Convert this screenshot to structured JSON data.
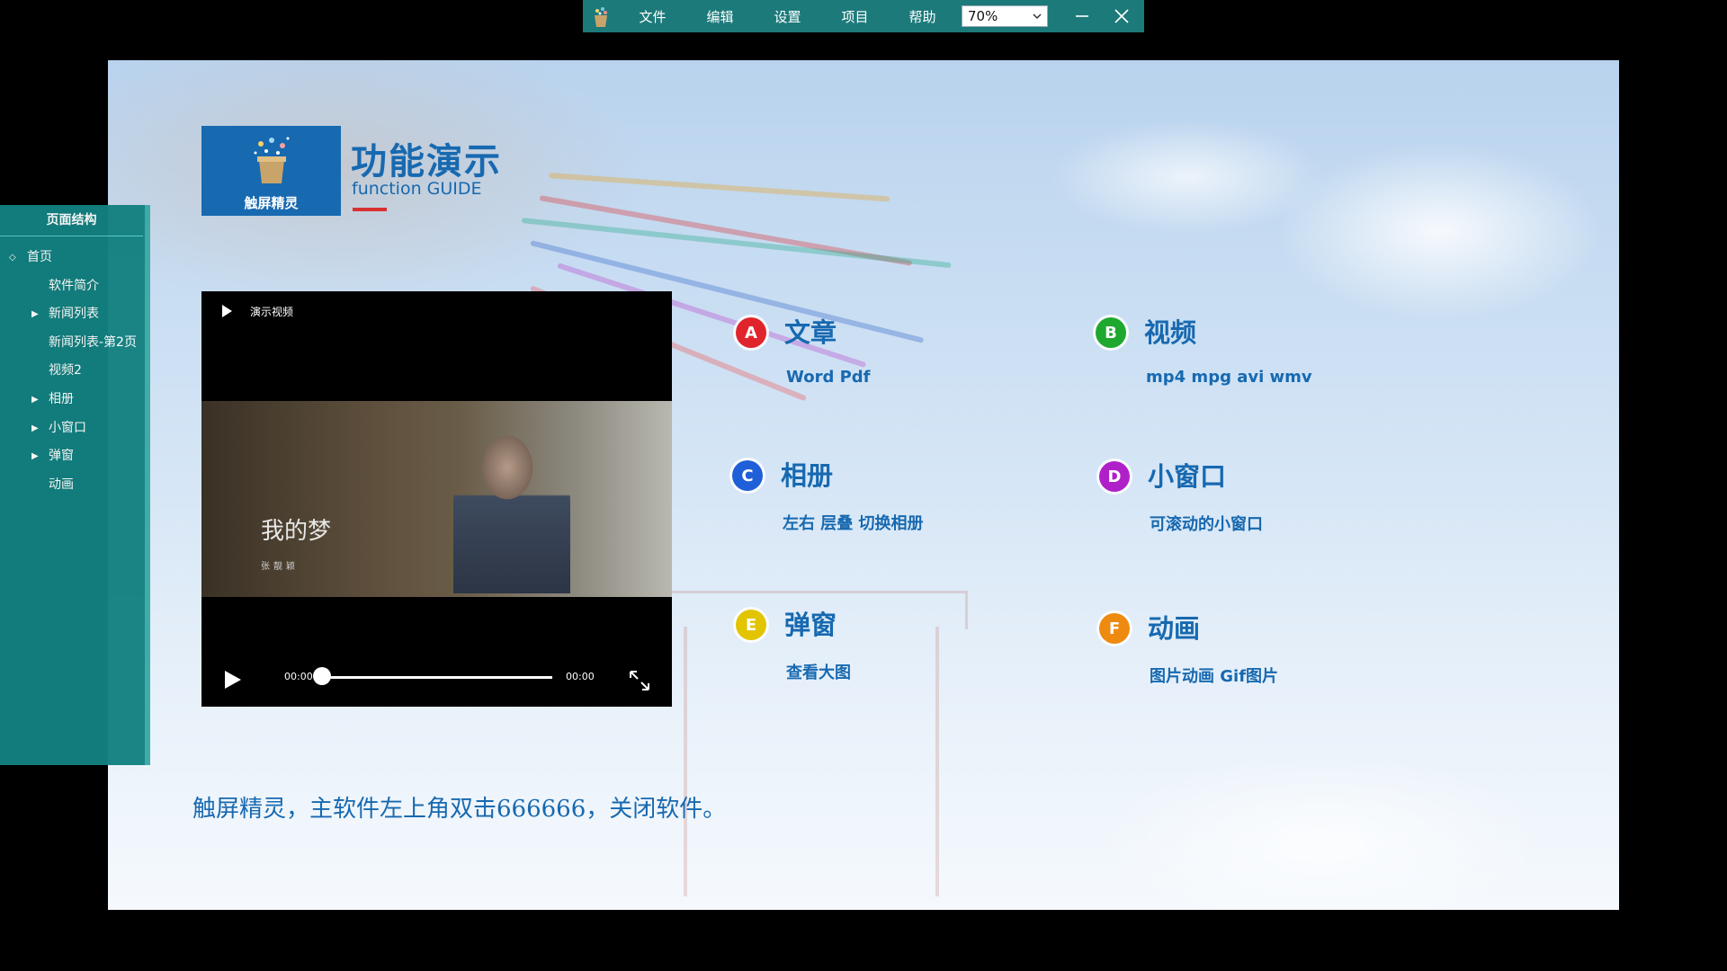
{
  "toolbar": {
    "menus": [
      "文件",
      "编辑",
      "设置",
      "项目",
      "帮助"
    ],
    "zoom": "70%"
  },
  "header": {
    "logo_label": "触屏精灵",
    "title": "功能演示",
    "subtitle": "function GUIDE"
  },
  "video": {
    "title": "演示视频",
    "overlay_title": "我的梦",
    "overlay_sub": "张靓颖",
    "current_time": "00:00",
    "duration": "00:00",
    "progress": 0
  },
  "features": [
    {
      "badge": "A",
      "color": "#e0242c",
      "title": "文章",
      "desc": "Word  Pdf"
    },
    {
      "badge": "B",
      "color": "#1fa82e",
      "title": "视频",
      "desc": "mp4  mpg  avi  wmv"
    },
    {
      "badge": "C",
      "color": "#1f5fd8",
      "title": "相册",
      "desc": "左右 层叠 切换相册"
    },
    {
      "badge": "D",
      "color": "#b020c8",
      "title": "小窗口",
      "desc": "可滚动的小窗口"
    },
    {
      "badge": "E",
      "color": "#e2c400",
      "title": "弹窗",
      "desc": "查看大图"
    },
    {
      "badge": "F",
      "color": "#ee8a10",
      "title": "动画",
      "desc": "图片动画  Gif图片"
    }
  ],
  "footer_text": "触屏精灵，主软件左上角双击666666，关闭软件。",
  "sidebar": {
    "title": "页面结构",
    "items": [
      {
        "label": "首页",
        "caret": "open"
      },
      {
        "label": "软件简介",
        "caret": ""
      },
      {
        "label": "新闻列表",
        "caret": "closed"
      },
      {
        "label": "新闻列表-第2页",
        "caret": ""
      },
      {
        "label": "视频2",
        "caret": ""
      },
      {
        "label": "相册",
        "caret": "closed"
      },
      {
        "label": "小窗口",
        "caret": "closed"
      },
      {
        "label": "弹窗",
        "caret": "closed"
      },
      {
        "label": "动画",
        "caret": ""
      }
    ]
  }
}
